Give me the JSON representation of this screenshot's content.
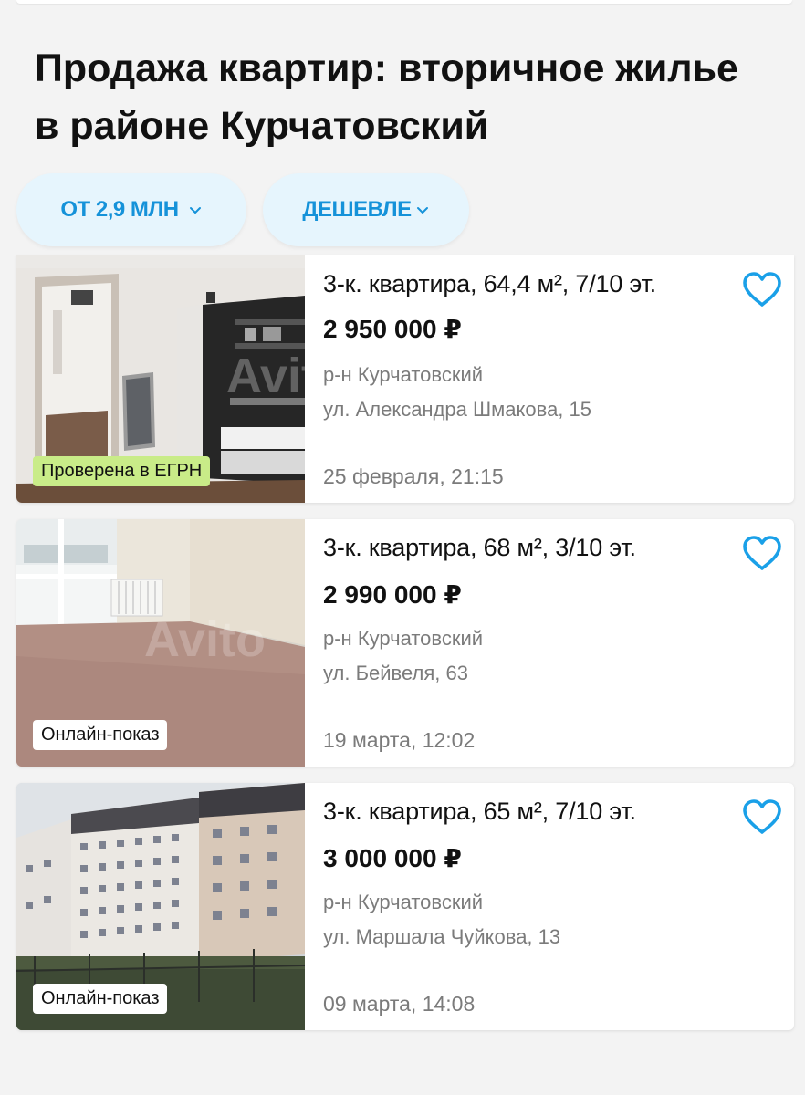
{
  "page": {
    "title": "Продажа квартир: вторичное жилье в районе Курчатовский"
  },
  "filters": {
    "price_label": "ОТ 2,9 МЛН",
    "sort_label": "ДЕШЕВЛЕ"
  },
  "colors": {
    "accent": "#1592d9",
    "chip_bg": "#e6f5fd",
    "badge_green": "#c9ec88",
    "favorite_icon": "#1aa0e8"
  },
  "listings": [
    {
      "title": "3-к. квартира, 64,4 м², 7/10 эт.",
      "price": "2 950 000 ₽",
      "district": "р-н Курчатовский",
      "address": "ул. Александра Шмакова, 15",
      "date": "25 февраля, 21:15",
      "badge": "Проверена в ЕГРН",
      "photo_watermark": "Avito",
      "favorite_icon": "heart-outline-icon"
    },
    {
      "title": "3-к. квартира, 68 м², 3/10 эт.",
      "price": "2 990 000 ₽",
      "district": "р-н Курчатовский",
      "address": "ул. Бейвеля, 63",
      "date": "19 марта, 12:02",
      "badge": "Онлайн-показ",
      "photo_watermark": "Avito",
      "favorite_icon": "heart-outline-icon"
    },
    {
      "title": "3-к. квартира, 65 м², 7/10 эт.",
      "price": "3 000 000 ₽",
      "district": "р-н Курчатовский",
      "address": "ул. Маршала Чуйкова, 13",
      "date": "09 марта, 14:08",
      "badge": "Онлайн-показ",
      "favorite_icon": "heart-outline-icon"
    }
  ]
}
